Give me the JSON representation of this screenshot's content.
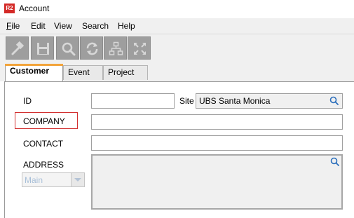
{
  "window": {
    "app_logo": "R2",
    "title": "Account"
  },
  "menu": [
    {
      "mnemonic": "F",
      "rest": "ile"
    },
    {
      "mnemonic": "",
      "rest": "Edit"
    },
    {
      "mnemonic": "",
      "rest": "View"
    },
    {
      "mnemonic": "",
      "rest": "Search"
    },
    {
      "mnemonic": "",
      "rest": "Help"
    }
  ],
  "toolbar": {
    "buttons": [
      "hammer-icon",
      "save-icon",
      "search-icon",
      "refresh-icon",
      "hierarchy-icon",
      "expand-icon"
    ]
  },
  "tabs": [
    {
      "label": "Customer",
      "active": true
    },
    {
      "label": "Event",
      "active": false
    },
    {
      "label": "Project",
      "active": false
    }
  ],
  "form": {
    "id_label": "ID",
    "id_value": "",
    "site_label": "Site",
    "site_value": "UBS Santa Monica",
    "company_label": "COMPANY",
    "company_value": "",
    "contact_label": "CONTACT",
    "contact_value": "",
    "address_label": "ADDRESS",
    "address_value": "",
    "address_type": "Main"
  },
  "colors": {
    "highlight_border": "#d23030",
    "active_tab_accent": "#f2a43b",
    "search_icon": "#2a6ebb"
  }
}
